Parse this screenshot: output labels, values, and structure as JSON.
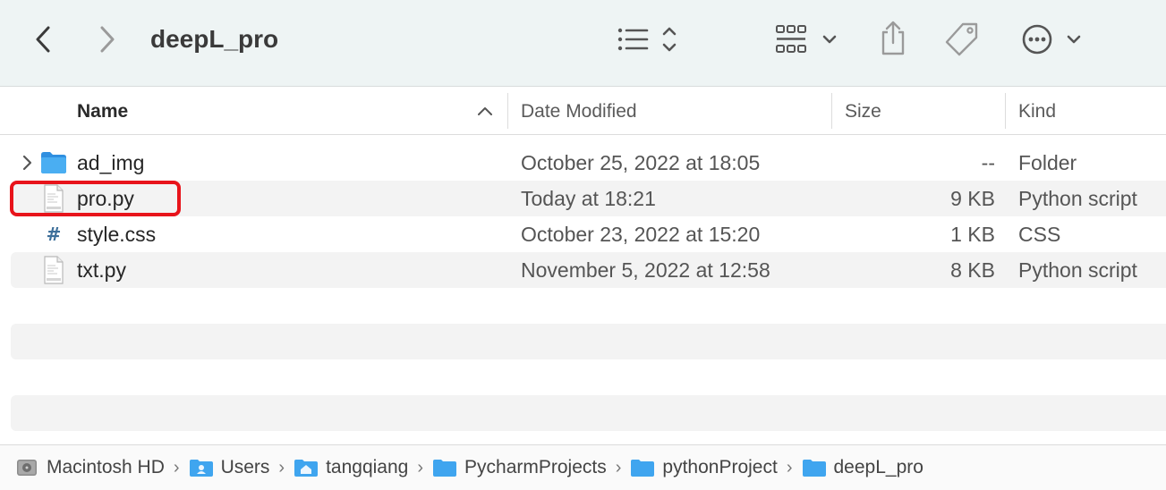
{
  "window": {
    "title": "deepL_pro"
  },
  "toolbar": {
    "back_icon": "chevron-left-icon",
    "forward_icon": "chevron-right-icon",
    "view_icon": "list-view-icon",
    "group_icon": "grid-group-icon",
    "share_icon": "share-icon",
    "tag_icon": "tag-icon",
    "more_icon": "ellipsis-circle-icon"
  },
  "columns": {
    "name": "Name",
    "date": "Date Modified",
    "size": "Size",
    "kind": "Kind"
  },
  "files": [
    {
      "name": "ad_img",
      "date": "October 25, 2022 at 18:05",
      "size": "--",
      "kind": "Folder",
      "icon": "folder-icon"
    },
    {
      "name": "pro.py",
      "date": "Today at 18:21",
      "size": "9 KB",
      "kind": "Python script",
      "icon": "python-file-icon"
    },
    {
      "name": "style.css",
      "date": "October 23, 2022 at 15:20",
      "size": "1 KB",
      "kind": "CSS",
      "icon": "css-file-icon"
    },
    {
      "name": "txt.py",
      "date": "November 5, 2022 at 12:58",
      "size": "8 KB",
      "kind": "Python script",
      "icon": "python-file-icon"
    }
  ],
  "pathbar": [
    {
      "label": "Macintosh HD",
      "icon": "hard-drive-icon"
    },
    {
      "label": "Users",
      "icon": "users-folder-icon"
    },
    {
      "label": "tangqiang",
      "icon": "home-folder-icon"
    },
    {
      "label": "PycharmProjects",
      "icon": "folder-icon"
    },
    {
      "label": "pythonProject",
      "icon": "folder-icon"
    },
    {
      "label": "deepL_pro",
      "icon": "folder-icon"
    }
  ],
  "colors": {
    "toolbar_bg": "#eef4f4",
    "folder_blue": "#3fa5ef",
    "highlight_red": "#e8141b"
  }
}
